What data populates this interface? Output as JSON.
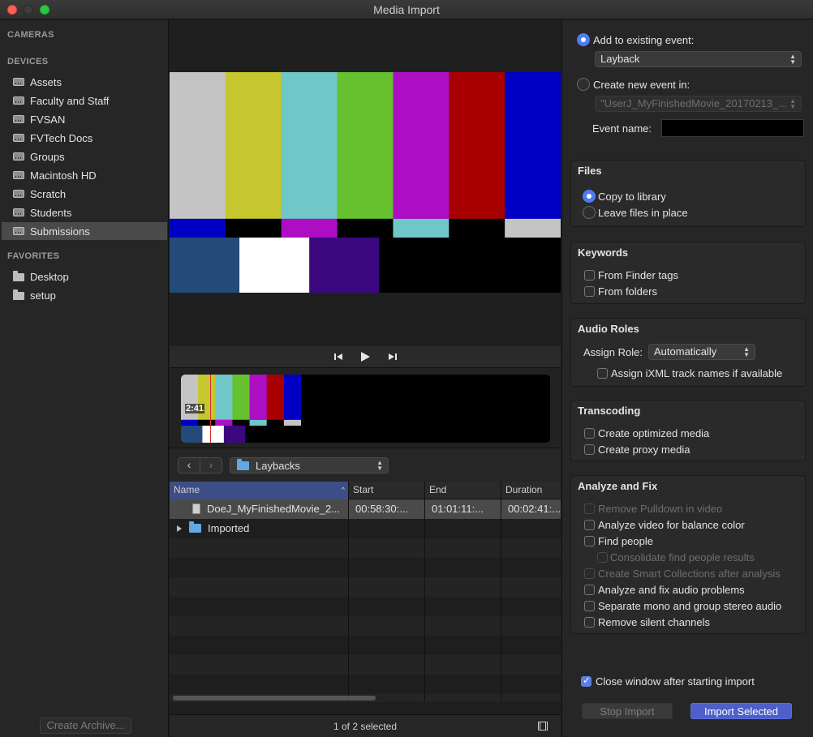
{
  "window": {
    "title": "Media Import"
  },
  "sidebar": {
    "cameras_header": "CAMERAS",
    "devices_header": "DEVICES",
    "devices": [
      {
        "label": "Assets"
      },
      {
        "label": "Faculty and Staff"
      },
      {
        "label": "FVSAN"
      },
      {
        "label": "FVTech Docs"
      },
      {
        "label": "Groups"
      },
      {
        "label": "Macintosh HD"
      },
      {
        "label": "Scratch"
      },
      {
        "label": "Students"
      },
      {
        "label": "Submissions"
      }
    ],
    "selected_device": "Submissions",
    "favorites_header": "FAVORITES",
    "favorites": [
      {
        "label": "Desktop"
      },
      {
        "label": "setup"
      }
    ],
    "create_archive_label": "Create Archive..."
  },
  "filmstrip": {
    "timecode": "2:41"
  },
  "browser": {
    "folder": "Laybacks",
    "columns": [
      "Name",
      "Start",
      "End",
      "Duration"
    ],
    "rows": [
      {
        "name": "DoeJ_MyFinishedMovie_2...",
        "start": "00:58:30:...",
        "end": "01:01:11:...",
        "duration": "00:02:41:..."
      },
      {
        "name": "Imported",
        "start": "",
        "end": "",
        "duration": ""
      }
    ],
    "status": "1 of 2 selected"
  },
  "options": {
    "add_existing_label": "Add to existing event:",
    "existing_event": "Layback",
    "create_new_label": "Create new event in:",
    "new_event_library": "\"UserJ_MyFinishedMovie_20170213_...",
    "event_name_label": "Event name:",
    "event_name_value": "",
    "files": {
      "title": "Files",
      "copy_label": "Copy to library",
      "leave_label": "Leave files in place"
    },
    "keywords": {
      "title": "Keywords",
      "finder_tags": "From Finder tags",
      "folders": "From folders"
    },
    "audio_roles": {
      "title": "Audio Roles",
      "assign_role_label": "Assign Role:",
      "assign_role_value": "Automatically",
      "ixml_label": "Assign iXML track names if available"
    },
    "transcoding": {
      "title": "Transcoding",
      "optimized": "Create optimized media",
      "proxy": "Create proxy media"
    },
    "analyze": {
      "title": "Analyze and Fix",
      "pulldown": "Remove Pulldown in video",
      "balance": "Analyze video for balance color",
      "find_people": "Find people",
      "consolidate": "Consolidate find people results",
      "smart_collections": "Create Smart Collections after analysis",
      "audio_problems": "Analyze and fix audio problems",
      "mono_stereo": "Separate mono and group stereo audio",
      "silent": "Remove silent channels"
    },
    "close_window_label": "Close window after starting import",
    "stop_import_label": "Stop Import",
    "import_selected_label": "Import Selected"
  },
  "colors": {
    "accent": "#4e7cf2",
    "primary_button": "#4d5fc8",
    "bars_top": [
      "#c4c4c4",
      "#c6c62e",
      "#6fc7c7",
      "#66c12e",
      "#ad0ec4",
      "#a80000",
      "#0000c4"
    ],
    "bars_mid": [
      "#0000c4",
      "#000000",
      "#ad0ec4",
      "#000000",
      "#6fc7c7",
      "#000000",
      "#c4c4c4"
    ],
    "bars_bottom": [
      "#244a79",
      "#ffffff",
      "#3b0880",
      "#000000",
      "#000000",
      "#000000"
    ]
  }
}
